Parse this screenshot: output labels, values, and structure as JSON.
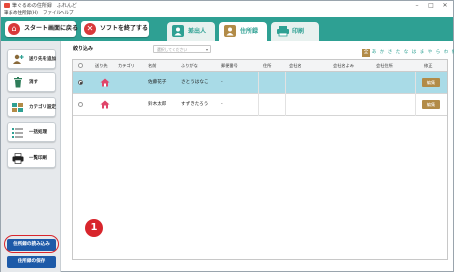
{
  "window": {
    "title": "筆ぐるめの住所録　ふれんど",
    "controls": [
      "–",
      "□",
      "✕"
    ]
  },
  "menu": {
    "items": [
      "筆まめ住所録(H)",
      "ファイル",
      "ヘルプ"
    ]
  },
  "header": {
    "back_button": "スタート画面に戻る",
    "exit_button": "ソフトを終了する",
    "tabs": [
      {
        "label": "差出人",
        "selected": false
      },
      {
        "label": "住所録",
        "selected": true
      },
      {
        "label": "印刷",
        "selected": false
      }
    ]
  },
  "sidebar": {
    "items": [
      {
        "label": "送り先を追加",
        "icon": "add-person-icon"
      },
      {
        "label": "消す",
        "icon": "trash-icon"
      },
      {
        "label": "カテゴリ設定",
        "icon": "category-icon"
      },
      {
        "label": "一括処理",
        "icon": "list-icon"
      },
      {
        "label": "一覧印刷",
        "icon": "printer-icon"
      }
    ],
    "load_button": "住所録の読み込み",
    "save_button": "住所録の保存"
  },
  "filter": {
    "label": "絞り込み",
    "placeholder": "選択してください"
  },
  "kana_index": [
    "全",
    "あ",
    "か",
    "さ",
    "た",
    "な",
    "は",
    "ま",
    "や",
    "ら",
    "わ",
    "他"
  ],
  "table": {
    "columns": [
      "",
      "送り先",
      "カテゴリ",
      "名前",
      "ふりがな",
      "郵便番号",
      "住所",
      "会社名",
      "会社名よみ",
      "会社住所",
      "修正"
    ],
    "rows": [
      {
        "selected": true,
        "name": "佐藤花子",
        "furigana": "さとうはなこ",
        "zip": "-",
        "edit": "編集"
      },
      {
        "selected": false,
        "name": "鈴木太郎",
        "furigana": "すずきたろう",
        "zip": "-",
        "edit": "編集"
      }
    ]
  },
  "annotation": {
    "badge": "1"
  },
  "colors": {
    "header": "#2ea093",
    "accent_gold": "#b28b47",
    "selected_row": "#a9dbe7",
    "primary_blue": "#1d5aa8",
    "callout_red": "#d8252c"
  }
}
